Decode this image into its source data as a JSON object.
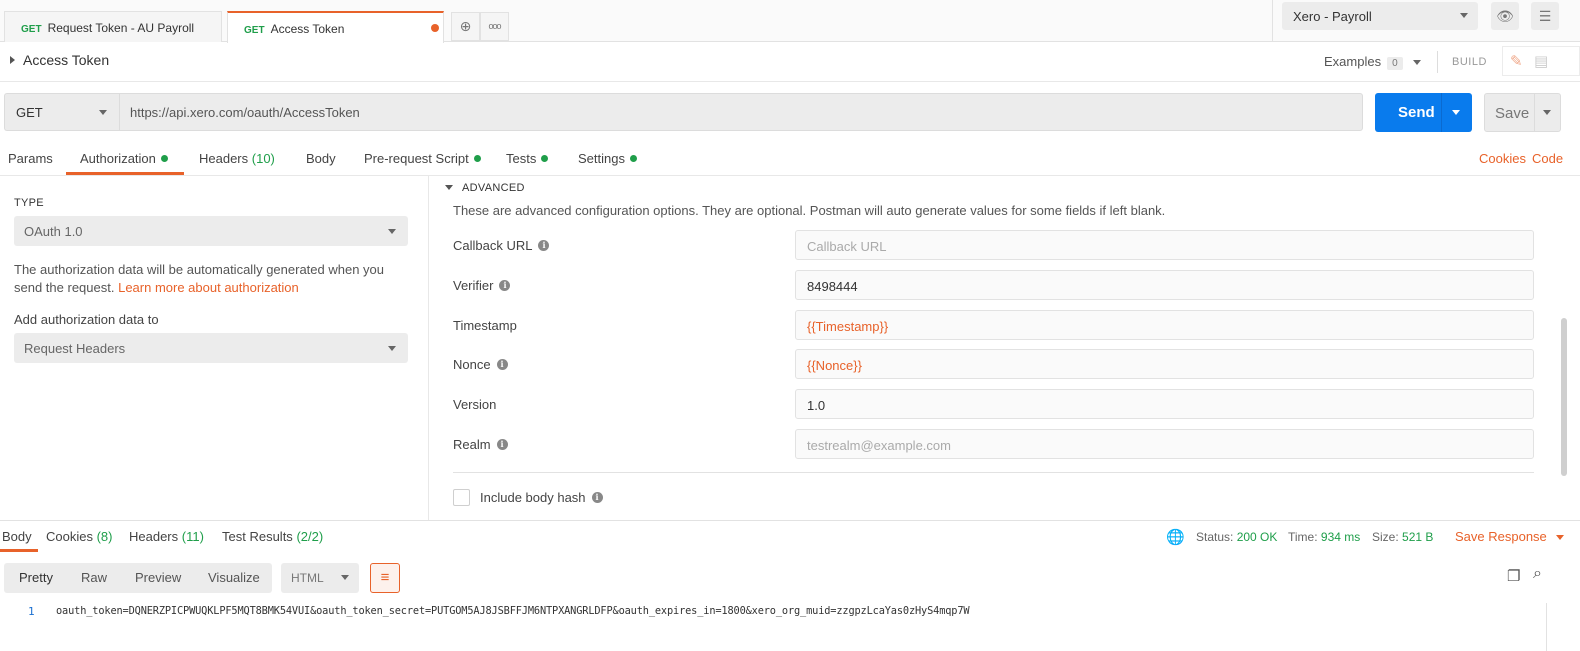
{
  "tabs": [
    {
      "method": "GET",
      "label": "Request Token - AU Payroll",
      "active": false
    },
    {
      "method": "GET",
      "label": "Access Token",
      "active": true,
      "unsaved": true
    }
  ],
  "tab_actions": {
    "new_tab": "⊕",
    "more": "ooo"
  },
  "environment": {
    "selected": "Xero - Payroll"
  },
  "request": {
    "title": "Access Token",
    "examples_label": "Examples",
    "examples_count": "0",
    "build_label": "BUILD",
    "method": "GET",
    "url": "https://api.xero.com/oauth/AccessToken",
    "send_label": "Send",
    "save_label": "Save"
  },
  "request_tabs": [
    {
      "label": "Params",
      "dot": false
    },
    {
      "label": "Authorization",
      "dot": true,
      "active": true
    },
    {
      "label": "Headers",
      "count": "(10)",
      "dot": false
    },
    {
      "label": "Body",
      "dot": false
    },
    {
      "label": "Pre-request Script",
      "dot": true
    },
    {
      "label": "Tests",
      "dot": true
    },
    {
      "label": "Settings",
      "dot": true
    }
  ],
  "request_links": {
    "cookies": "Cookies",
    "code": "Code"
  },
  "auth": {
    "type_label": "TYPE",
    "type_value": "OAuth 1.0",
    "description": "The authorization data will be automatically generated when you send the request.",
    "learn_more": "Learn more about authorization",
    "add_to_label": "Add authorization data to",
    "add_to_value": "Request Headers"
  },
  "advanced": {
    "heading": "ADVANCED",
    "description": "These are advanced configuration options. They are optional. Postman will auto generate values for some fields if left blank.",
    "fields": {
      "callback_url": {
        "label": "Callback URL",
        "value": "",
        "placeholder": "Callback URL"
      },
      "verifier": {
        "label": "Verifier",
        "value": "8498444"
      },
      "timestamp": {
        "label": "Timestamp",
        "value": "{{Timestamp}}"
      },
      "nonce": {
        "label": "Nonce",
        "value": "{{Nonce}}"
      },
      "version": {
        "label": "Version",
        "value": "1.0"
      },
      "realm": {
        "label": "Realm",
        "value": "",
        "placeholder": "testrealm@example.com"
      }
    },
    "include_body_hash": {
      "label": "Include body hash",
      "checked": false
    }
  },
  "response": {
    "tabs": [
      {
        "label": "Body",
        "active": true
      },
      {
        "label": "Cookies",
        "count": "(8)"
      },
      {
        "label": "Headers",
        "count": "(11)"
      },
      {
        "label": "Test Results",
        "count": "(2/2)"
      }
    ],
    "status_label": "Status:",
    "status_value": "200 OK",
    "time_label": "Time:",
    "time_value": "934 ms",
    "size_label": "Size:",
    "size_value": "521 B",
    "save_response": "Save Response",
    "view_modes": [
      "Pretty",
      "Raw",
      "Preview",
      "Visualize"
    ],
    "view_active": "Pretty",
    "language": "HTML",
    "line_number": "1",
    "body": "oauth_token=DQNERZPICPWUQKLPF5MQT8BMK54VUI&oauth_token_secret=PUTGOM5AJ8JSBFFJM6NTPXANGRLDFP&oauth_expires_in=1800&xero_org_muid=zzgpzLcaYas0zHyS4mqp7W"
  },
  "colors": {
    "accent": "#e8622a",
    "send": "#097bed",
    "success": "#1f9e4a"
  }
}
